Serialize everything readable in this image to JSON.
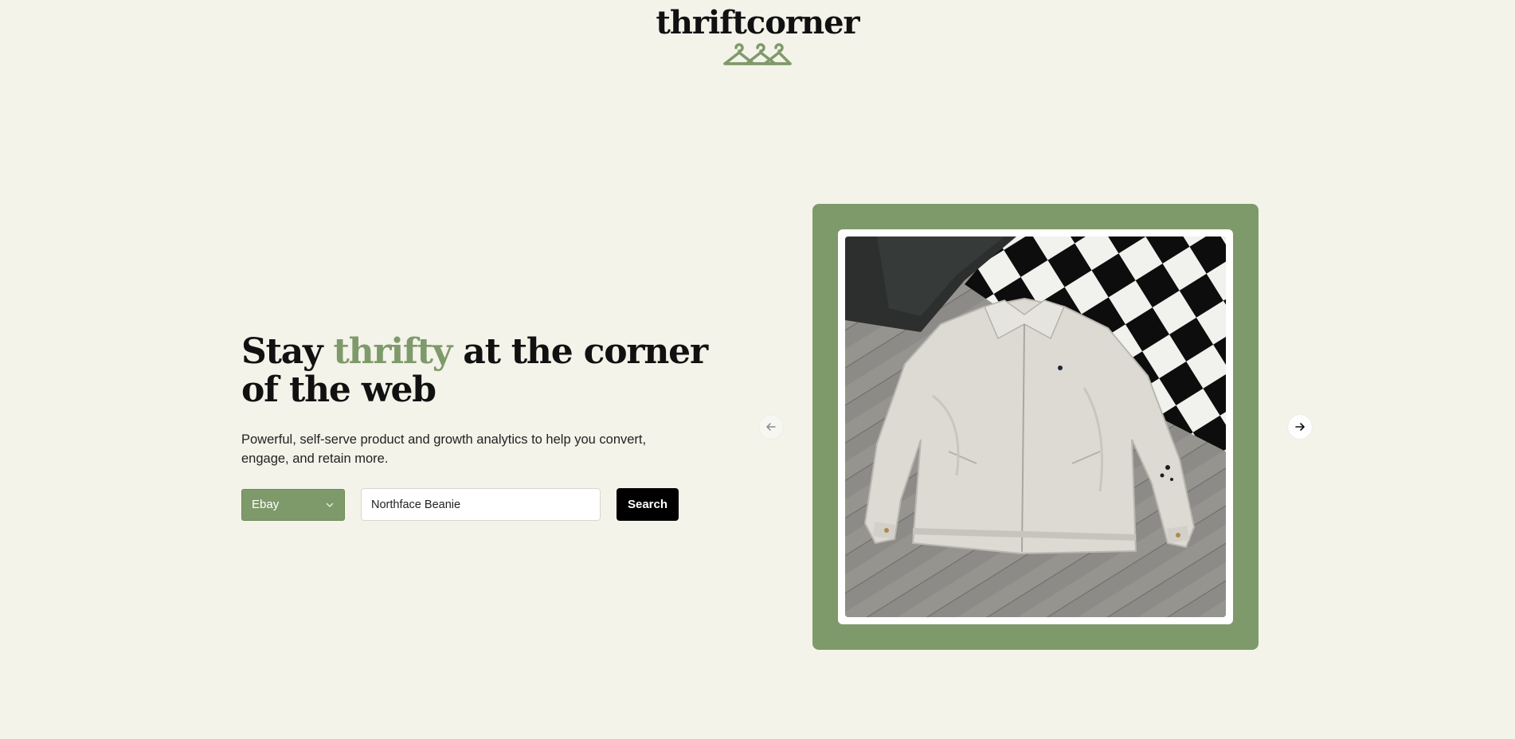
{
  "header": {
    "brand": "thriftcorner",
    "logo_icon": "hangers-icon",
    "brand_color": "#7f9a6a"
  },
  "hero": {
    "headline_part1": "Stay ",
    "headline_accent": "thrifty",
    "headline_part2": " at the corner of the web",
    "subtext": "Powerful, self-serve product and growth analytics to help you convert, engage, and retain more."
  },
  "search": {
    "marketplace_selected": "Ebay",
    "query_value": "Northface Beanie",
    "button_label": "Search"
  },
  "carousel": {
    "prev_icon": "arrow-left-icon",
    "next_icon": "arrow-right-icon",
    "image_alt": "white zip jacket product photo"
  },
  "colors": {
    "background": "#f3f3ea",
    "accent": "#7f9a6a",
    "button": "#000000"
  }
}
